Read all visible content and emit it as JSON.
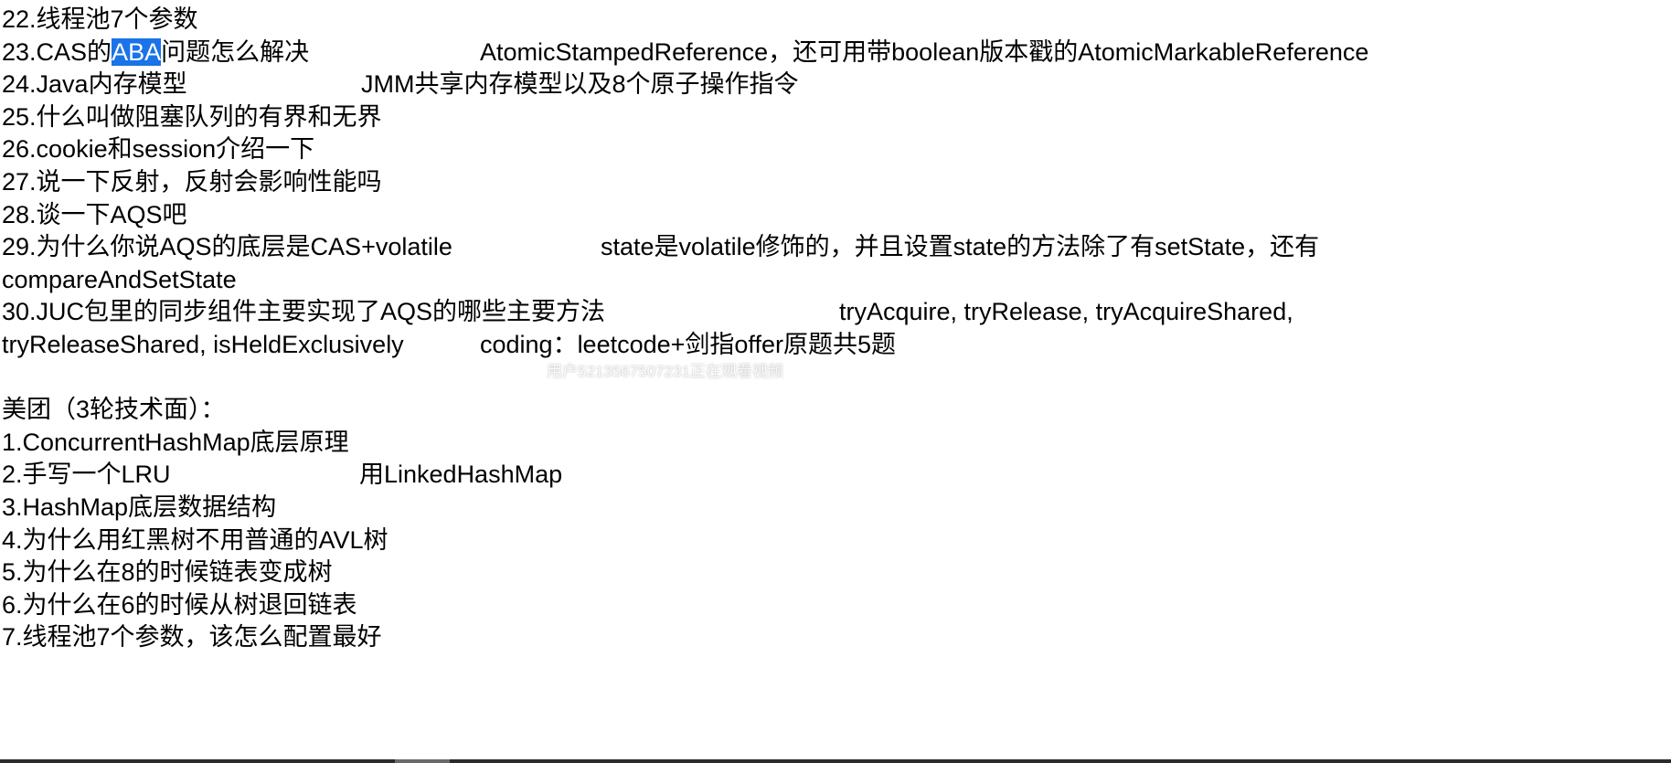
{
  "lines": [
    {
      "c1": "22.线程池7个参数"
    },
    {
      "c1_pre": "23.CAS的",
      "c1_hl": "ABA",
      "c1_post": "问题怎么解决",
      "c2": "AtomicStampedReference，还可用带boolean版本戳的AtomicMarkableReference"
    },
    {
      "c1": "24.Java内存模型",
      "c2": "JMM共享内存模型以及8个原子操作指令"
    },
    {
      "c1": "25.什么叫做阻塞队列的有界和无界"
    },
    {
      "c1": "26.cookie和session介绍一下"
    },
    {
      "c1": "27.说一下反射，反射会影响性能吗"
    },
    {
      "c1": "28.谈一下AQS吧"
    },
    {
      "c1": "29.为什么你说AQS的底层是CAS+volatile",
      "c2": "state是volatile修饰的，并且设置state的方法除了有setState，还有"
    },
    {
      "c1": "compareAndSetState"
    },
    {
      "c1": "30.JUC包里的同步组件主要实现了AQS的哪些主要方法",
      "c2": "tryAcquire, tryRelease, tryAcquireShared,"
    },
    {
      "c1": "tryReleaseShared, isHeldExclusively",
      "c2": "coding：leetcode+剑指offer原题共5题"
    },
    {
      "c1": ""
    },
    {
      "c1": "美团（3轮技术面）："
    },
    {
      "c1": "1.ConcurrentHashMap底层原理"
    },
    {
      "c1": "2.手写一个LRU",
      "c2": "用LinkedHashMap"
    },
    {
      "c1": "3.HashMap底层数据结构"
    },
    {
      "c1": "4.为什么用红黑树不用普通的AVL树"
    },
    {
      "c1": "5.为什么在8的时候链表变成树"
    },
    {
      "c1": "6.为什么在6的时候从树退回链表"
    },
    {
      "c1": "7.线程池7个参数，该怎么配置最好"
    }
  ],
  "watermark": "用户5213567507231正在观看视频",
  "colors": {
    "highlight": "#1a73e8",
    "text": "#000000",
    "background": "#ffffff"
  }
}
